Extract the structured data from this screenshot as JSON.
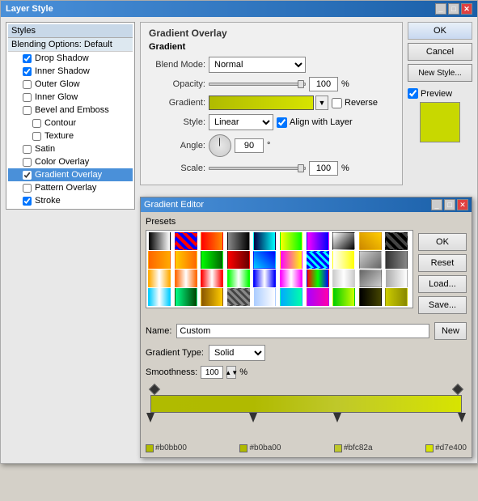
{
  "dialog": {
    "title": "Layer Style",
    "buttons": {
      "ok": "OK",
      "cancel": "Cancel",
      "new_style": "New Style...",
      "preview_label": "Preview"
    }
  },
  "left_panel": {
    "header": "Styles",
    "blending_header": "Blending Options: Default",
    "items": [
      {
        "label": "Drop Shadow",
        "checked": true
      },
      {
        "label": "Inner Shadow",
        "checked": true
      },
      {
        "label": "Outer Glow",
        "checked": false
      },
      {
        "label": "Inner Glow",
        "checked": false
      },
      {
        "label": "Bevel and Emboss",
        "checked": false
      },
      {
        "label": "Contour",
        "checked": false
      },
      {
        "label": "Texture",
        "checked": false
      },
      {
        "label": "Satin",
        "checked": false
      },
      {
        "label": "Color Overlay",
        "checked": false
      },
      {
        "label": "Gradient Overlay",
        "checked": true,
        "selected": true
      },
      {
        "label": "Pattern Overlay",
        "checked": false
      },
      {
        "label": "Stroke",
        "checked": true
      }
    ]
  },
  "gradient_overlay": {
    "section_title": "Gradient Overlay",
    "sub_title": "Gradient",
    "blend_mode_label": "Blend Mode:",
    "blend_mode_value": "Normal",
    "opacity_label": "Opacity:",
    "opacity_value": "100",
    "opacity_unit": "%",
    "gradient_label": "Gradient:",
    "reverse_label": "Reverse",
    "style_label": "Style:",
    "style_value": "Linear",
    "align_layer_label": "Align with Layer",
    "angle_label": "Angle:",
    "angle_value": "90",
    "angle_unit": "°",
    "scale_label": "Scale:",
    "scale_value": "100",
    "scale_unit": "%"
  },
  "gradient_editor": {
    "title": "Gradient Editor",
    "presets_label": "Presets",
    "buttons": {
      "ok": "OK",
      "reset": "Reset",
      "load": "Load...",
      "save": "Save..."
    },
    "name_label": "Name:",
    "name_value": "Custom",
    "new_btn": "New",
    "gradient_type_label": "Gradient Type:",
    "gradient_type_value": "Solid",
    "smoothness_label": "Smoothness:",
    "smoothness_value": "100",
    "smoothness_unit": "%",
    "color_stops": [
      {
        "position": 0,
        "color": "#b0bb00",
        "label": "#b0bb00"
      },
      {
        "position": 33,
        "color": "#b0ba00",
        "label": "#b0ba00"
      },
      {
        "position": 60,
        "color": "#bfc82a",
        "label": "#bfc82a"
      },
      {
        "position": 100,
        "color": "#d7e400",
        "label": "#d7e400"
      }
    ],
    "presets": [
      [
        "#000000",
        "#ffffff",
        "linear-gradient(to right, #000, #fff)"
      ],
      [
        "#0000ff",
        "#ff0000",
        "repeating-linear-gradient(45deg, #00f, #f00)"
      ],
      [
        "#ff0000",
        "#ff8800",
        "linear-gradient(to right, #f00, #f80)"
      ],
      [
        "#888888",
        "#000000",
        "linear-gradient(to right, #888, #000)"
      ],
      [
        "#0044ff",
        "#00ffff",
        "linear-gradient(to right, #004f, #0ff)"
      ],
      [
        "#ffff00",
        "#00ff00",
        "linear-gradient(to right, #ff0, #0f0)"
      ],
      [
        "#ff00ff",
        "#0000ff",
        "linear-gradient(to right, #f0f, #00f)"
      ],
      [
        "#ffffff",
        "#000000",
        "linear-gradient(to bottom right, #fff, #000)"
      ],
      [
        "#cc8800",
        "#ffcc00",
        "linear-gradient(45deg, #c80, #fc0)"
      ],
      [
        "#000000",
        "#444444",
        "repeating-linear-gradient(45deg, #000 0px, #000 4px, #444 4px, #444 8px)"
      ],
      [
        "#ff6600",
        "#ffaa00",
        "linear-gradient(to right, #f60, #fa0)"
      ],
      [
        "#ffcc00",
        "#ff6600",
        "linear-gradient(to right, #fc0, #f60)"
      ],
      [
        "#00ff00",
        "#006600",
        "linear-gradient(to right, #0f0, #060)"
      ],
      [
        "#ff0000",
        "#660000",
        "linear-gradient(to right, #f00, #600)"
      ],
      [
        "#00ccff",
        "#0000ff",
        "linear-gradient(45deg, #0cf, #00f)"
      ],
      [
        "#ff00ff",
        "#ffff00",
        "linear-gradient(to right, #f0f, #ff0)"
      ],
      [
        "#0000ff",
        "#00ffff",
        "repeating-linear-gradient(45deg, #00f, #0ff 5px)"
      ],
      [
        "#ffffff",
        "#ffff00",
        "linear-gradient(to right, #fff, #ff0)"
      ],
      [
        "#cccccc",
        "#666666",
        "linear-gradient(45deg, #ccc, #666)"
      ],
      [
        "#333333",
        "#888888",
        "linear-gradient(to right, #333, #888)"
      ],
      [
        "#ffaa00",
        "#ffffff",
        "linear-gradient(to right, #fa0 0%, #fff 50%, #fa0 100%)"
      ],
      [
        "#ff6600",
        "#ffffff",
        "linear-gradient(to right, #f60 0%, #fff 50%, #f60 100%)"
      ],
      [
        "#ff0000",
        "#ffffff",
        "linear-gradient(to right, #f00 0%, #fff 50%, #f00 100%)"
      ],
      [
        "#00ff00",
        "#ffffff",
        "linear-gradient(to right, #0f0 0%, #fff 50%, #0f0 100%)"
      ],
      [
        "#0000ff",
        "#ffffff",
        "linear-gradient(to right, #00f 0%, #fff 50%, #00f 100%)"
      ],
      [
        "#ff00ff",
        "#ffffff",
        "linear-gradient(to right, #f0f 0%, #fff 50%, #f0f 100%)"
      ],
      [
        "#ff0000",
        "#00ff00",
        "linear-gradient(to right, #f00, #0f0, #00f)"
      ],
      [
        "#cccccc",
        "#ffffff",
        "linear-gradient(to right, #ccc 0%, #fff 50%, #ccc 100%)"
      ],
      [
        "#666666",
        "#cccccc",
        "linear-gradient(45deg, #666, #ccc)"
      ],
      [
        "#aaaaaa",
        "#ffffff",
        "linear-gradient(to right, #aaa 0%, #fff 100%)"
      ],
      [
        "#00ccff",
        "#ffffff",
        "linear-gradient(to right, #0cf 0%, #fff 50%, #0cf 100%)"
      ],
      [
        "#00ff88",
        "#004400",
        "linear-gradient(to right, #0f8, #040)"
      ],
      [
        "#885500",
        "#ffcc00",
        "linear-gradient(to right, #850, #fc0)"
      ],
      [
        "#888888",
        "#444444",
        "repeating-linear-gradient(45deg, #888 0px, #888 3px, #444 3px, #444 6px)"
      ],
      [
        "#aaccff",
        "#ffffff",
        "linear-gradient(to right, #acf 0%, #fff 100%)"
      ],
      [
        "#00aaff",
        "#00ffaa",
        "linear-gradient(to right, #0af, #0fa)"
      ],
      [
        "#aa00ff",
        "#ff00aa",
        "linear-gradient(to right, #a0f, #f0a)"
      ],
      [
        "#00cc00",
        "#ccff00",
        "linear-gradient(to right, #0c0, #cf0)"
      ],
      [
        "#000000",
        "#444400",
        "linear-gradient(to right, #000, #440)"
      ],
      [
        "#cccc00",
        "#888800",
        "linear-gradient(to right, #cc0, #880)"
      ]
    ]
  }
}
